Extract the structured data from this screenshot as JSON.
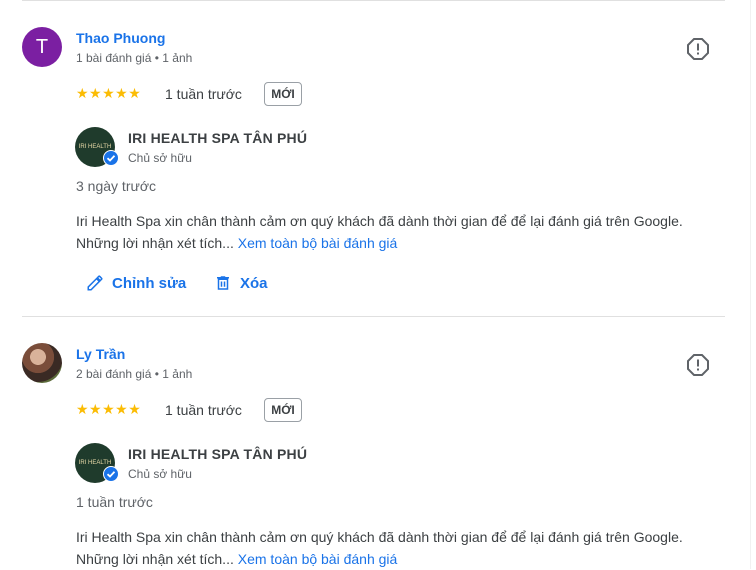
{
  "reviews": [
    {
      "avatar_letter": "T",
      "name": "Thao Phuong",
      "meta": "1 bài đánh giá • 1 ảnh",
      "stars": "★★★★★",
      "rating": 5,
      "time": "1 tuần trước",
      "badge": "MỚI",
      "owner": {
        "name": "IRI HEALTH SPA TÂN PHÚ",
        "role": "Chủ sở hữu",
        "logo_text": "IRI HEALTH",
        "reply_time": "3 ngày trước",
        "reply_text": "Iri Health Spa xin chân thành cảm ơn quý khách đã dành thời gian để để lại đánh giá trên Google. Những lời nhận xét tích...",
        "more_link": "Xem toàn bộ bài đánh giá"
      },
      "actions": {
        "edit": "Chỉnh sửa",
        "delete": "Xóa"
      }
    },
    {
      "name": "Ly Trần",
      "meta": "2 bài đánh giá • 1 ảnh",
      "stars": "★★★★★",
      "rating": 5,
      "time": "1 tuần trước",
      "badge": "MỚI",
      "owner": {
        "name": "IRI HEALTH SPA TÂN PHÚ",
        "role": "Chủ sở hữu",
        "logo_text": "IRI HEALTH",
        "reply_time": "1 tuần trước",
        "reply_text": "Iri Health Spa xin chân thành cảm ơn quý khách đã dành thời gian để để lại đánh giá trên Google. Những lời nhận xét tích...",
        "more_link": "Xem toàn bộ bài đánh giá"
      }
    }
  ],
  "colors": {
    "link": "#1a73e8",
    "star": "#fbbc04",
    "avatar_bg": "#7b1fa2",
    "logo_bg": "#1f3b2c"
  }
}
